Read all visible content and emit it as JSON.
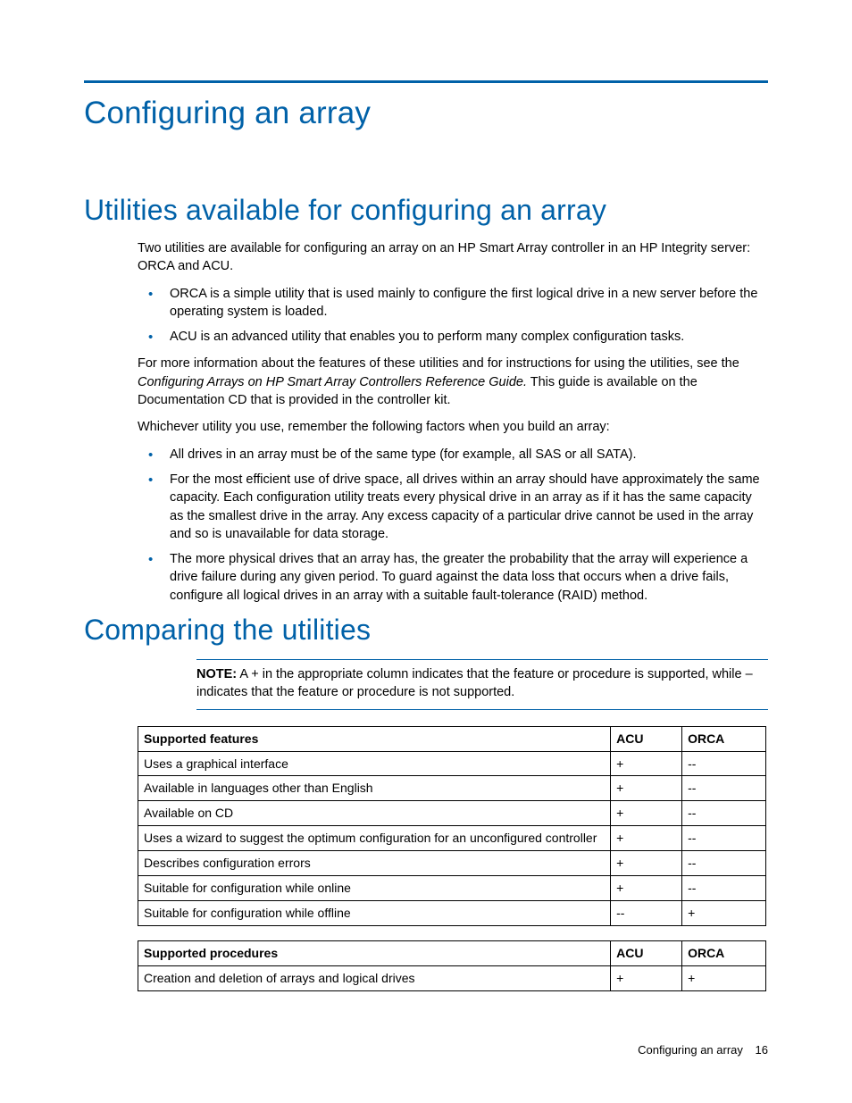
{
  "title": "Configuring an array",
  "section1": {
    "heading": "Utilities available for configuring an array",
    "intro": "Two utilities are available for configuring an array on an HP Smart Array controller in an HP Integrity server: ORCA and ACU.",
    "bullets1": [
      "ORCA is a simple utility that is used mainly to configure the first logical drive in a new server before the operating system is loaded.",
      "ACU is an advanced utility that enables you to perform many complex configuration tasks."
    ],
    "para2a": "For more information about the features of these utilities and for instructions for using the utilities, see the ",
    "para2_em": "Configuring Arrays on HP Smart Array Controllers Reference Guide.",
    "para2b": " This guide is available on the Documentation CD that is provided in the controller kit.",
    "para3": "Whichever utility you use, remember the following factors when you build an array:",
    "bullets2": [
      "All drives in an array must be of the same type (for example, all SAS or all SATA).",
      "For the most efficient use of drive space, all drives within an array should have approximately the same capacity. Each configuration utility treats every physical drive in an array as if it has the same capacity as the smallest drive in the array. Any excess capacity of a particular drive cannot be used in the array and so is unavailable for data storage.",
      "The more physical drives that an array has, the greater the probability that the array will experience a drive failure during any given period. To guard against the data loss that occurs when a drive fails, configure all logical drives in an array with a suitable fault-tolerance (RAID) method."
    ]
  },
  "section2": {
    "heading": "Comparing the utilities",
    "note_label": "NOTE:",
    "note_text": "  A + in the appropriate column indicates that the feature or procedure is supported, while – indicates that the feature or procedure is not supported."
  },
  "table1": {
    "headers": [
      "Supported features",
      "ACU",
      "ORCA"
    ],
    "rows": [
      [
        "Uses a graphical interface",
        "+",
        "--"
      ],
      [
        "Available in languages other than English",
        "+",
        "--"
      ],
      [
        "Available on CD",
        "+",
        "--"
      ],
      [
        "Uses a wizard to suggest the optimum configuration for an unconfigured controller",
        "+",
        "--"
      ],
      [
        "Describes configuration errors",
        "+",
        "--"
      ],
      [
        "Suitable for configuration while online",
        "+",
        "--"
      ],
      [
        "Suitable for configuration while offline",
        "--",
        "+"
      ]
    ]
  },
  "table2": {
    "headers": [
      "Supported procedures",
      "ACU",
      "ORCA"
    ],
    "rows": [
      [
        "Creation and deletion of arrays and logical drives",
        "+",
        "+"
      ]
    ]
  },
  "footer": {
    "section": "Configuring an array",
    "page": "16"
  }
}
